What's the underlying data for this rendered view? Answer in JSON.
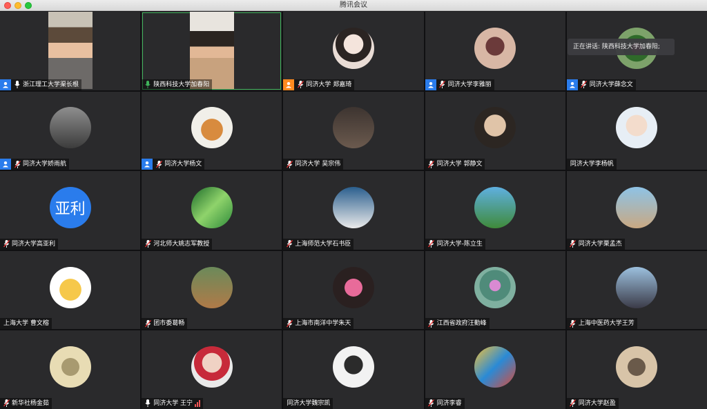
{
  "window": {
    "title": "腾讯会议"
  },
  "speaking_toast": "正在讲话: 陕西科技大学加春阳;",
  "accent_colors": {
    "host": "#2a7cec",
    "active_speaker": "#3fb35b",
    "mic": "#ffffff"
  },
  "participants": [
    {
      "name": "浙江理工大学渠长根",
      "badge": "host",
      "kind": "video"
    },
    {
      "name": "陕西科技大学加春阳",
      "badge": "none",
      "kind": "video",
      "speaking": true
    },
    {
      "name": "同济大学 郑嘉琦",
      "badge": "orange",
      "kind": "avatar"
    },
    {
      "name": "同济大学李雅丽",
      "badge": "host",
      "kind": "avatar"
    },
    {
      "name": "同济大学薛念文",
      "badge": "host",
      "kind": "avatar"
    },
    {
      "name": "同济大学娇雨航",
      "badge": "host",
      "kind": "avatar"
    },
    {
      "name": "同济大学杨文",
      "badge": "host",
      "kind": "avatar"
    },
    {
      "name": "同济大学 吴宗伟",
      "badge": "none",
      "kind": "avatar"
    },
    {
      "name": "同济大学 郭静文",
      "badge": "none",
      "kind": "avatar"
    },
    {
      "name": "同济大学李杨帆",
      "badge": "none",
      "kind": "avatar",
      "nomic": true
    },
    {
      "name": "同济大学高亚利",
      "badge": "none",
      "kind": "initial",
      "initial": "亚利"
    },
    {
      "name": "河北师大姚志军教授",
      "badge": "none",
      "kind": "avatar"
    },
    {
      "name": "上海师范大学石书臣",
      "badge": "none",
      "kind": "avatar"
    },
    {
      "name": "同济大学-陈立生",
      "badge": "none",
      "kind": "avatar"
    },
    {
      "name": "同济大学栗孟杰",
      "badge": "none",
      "kind": "avatar"
    },
    {
      "name": "上海大学 曹文榕",
      "badge": "none",
      "kind": "avatar",
      "nomic": true
    },
    {
      "name": "团市委葛畅",
      "badge": "none",
      "kind": "avatar"
    },
    {
      "name": "上海市南洋中学朱天",
      "badge": "none",
      "kind": "avatar"
    },
    {
      "name": "江西省政府汪勤峰",
      "badge": "none",
      "kind": "avatar"
    },
    {
      "name": "上海中医药大学王芳",
      "badge": "none",
      "kind": "avatar"
    },
    {
      "name": "新华社杨金茹",
      "badge": "none",
      "kind": "avatar"
    },
    {
      "name": "同济大学 王宁",
      "badge": "none",
      "kind": "avatar",
      "signal": true
    },
    {
      "name": "同济大学魏宗凯",
      "badge": "none",
      "kind": "avatar",
      "nomic": true
    },
    {
      "name": "同济李睿",
      "badge": "none",
      "kind": "avatar"
    },
    {
      "name": "同济大学赵盈",
      "badge": "none",
      "kind": "avatar"
    }
  ]
}
